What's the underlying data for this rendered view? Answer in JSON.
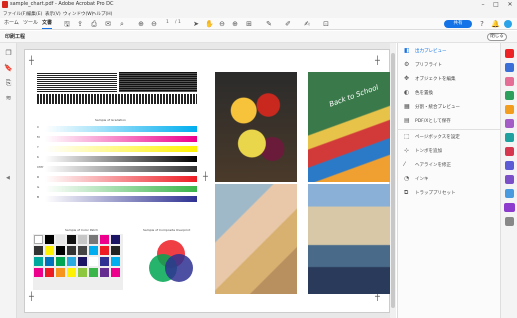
{
  "window": {
    "title": "sample_chart.pdf - Adobe Acrobat Pro DC",
    "minimize": "–",
    "maximize": "□",
    "close": "✕"
  },
  "menu": [
    "ファイル(F)",
    "編集(E)",
    "表示(V)",
    "ウィンドウ(W)",
    "ヘルプ(H)"
  ],
  "tabs": [
    "ホーム",
    "ツール",
    "文書"
  ],
  "toolbar": {
    "page_current": "1",
    "page_total": "/ 1",
    "share_label": "共有"
  },
  "subbar": {
    "title": "印刷工程",
    "close_label": "閉じる"
  },
  "right_panel": {
    "items": [
      "出力プレビュー",
      "プリフライト",
      "オブジェクトを編集",
      "色を置換",
      "分割・統合プレビュー",
      "PDF/Xとして保存",
      "ページボックスを設定",
      "トンボを追加",
      "ヘアラインを修正",
      "インキ",
      "トラッププリセット"
    ]
  },
  "page": {
    "gradation_title": "Sample of Gradation",
    "gradation_rows": [
      "C",
      "M",
      "Y",
      "K",
      "CMY",
      "R",
      "G",
      "B"
    ],
    "patch_title": "Sample of Color Patch",
    "overprint_title": "Sample of Composite Overprint",
    "book_text": "Back to School"
  },
  "colors": {
    "accent": "#1473e6"
  }
}
